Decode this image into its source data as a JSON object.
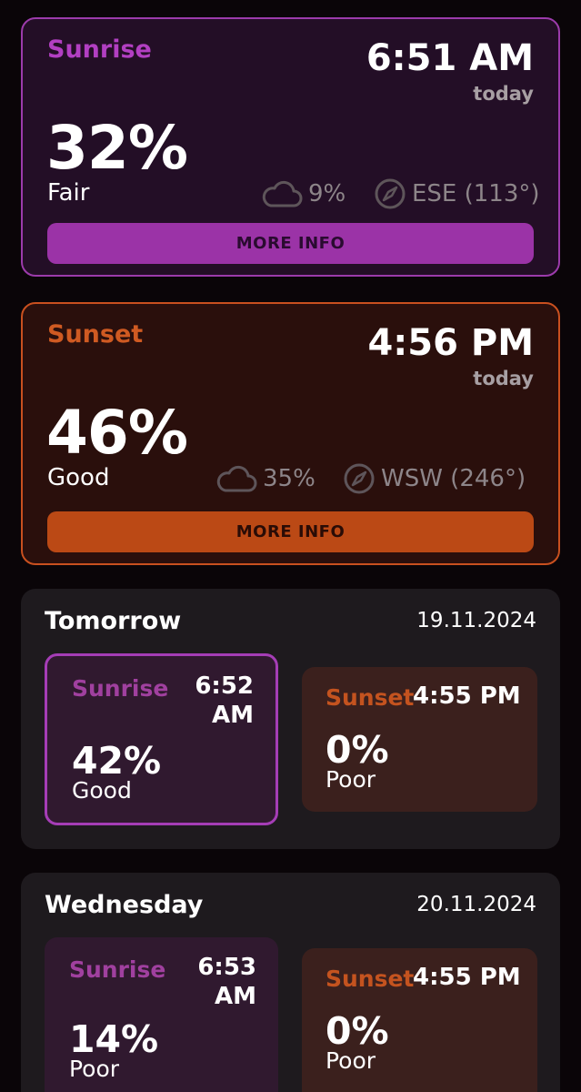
{
  "today_sunrise": {
    "label": "Sunrise",
    "time": "6:51 AM",
    "when": "today",
    "percent": "32%",
    "quality": "Fair",
    "cloud": "9%",
    "direction": "ESE (113°)",
    "button": "MORE INFO",
    "cloud_icon": "cloud-icon",
    "compass_icon": "compass-icon"
  },
  "today_sunset": {
    "label": "Sunset",
    "time": "4:56 PM",
    "when": "today",
    "percent": "46%",
    "quality": "Good",
    "cloud": "35%",
    "direction": "WSW (246°)",
    "button": "MORE INFO",
    "cloud_icon": "cloud-icon",
    "compass_icon": "compass-icon"
  },
  "days": [
    {
      "name": "Tomorrow",
      "date": "19.11.2024",
      "sunrise": {
        "label": "Sunrise",
        "time_hm": "6:52",
        "time_ampm": "AM",
        "percent": "42%",
        "quality": "Good"
      },
      "sunset": {
        "label": "Sunset",
        "time": "4:55 PM",
        "percent": "0%",
        "quality": "Poor"
      }
    },
    {
      "name": "Wednesday",
      "date": "20.11.2024",
      "sunrise": {
        "label": "Sunrise",
        "time_hm": "6:53",
        "time_ampm": "AM",
        "percent": "14%",
        "quality": "Poor"
      },
      "sunset": {
        "label": "Sunset",
        "time": "4:55 PM",
        "percent": "0%",
        "quality": "Poor"
      }
    }
  ],
  "colors": {
    "sunrise_accent": "#9c3bab",
    "sunset_accent": "#c9501f",
    "background": "#0a0508",
    "day_card": "#1e1a1e"
  }
}
